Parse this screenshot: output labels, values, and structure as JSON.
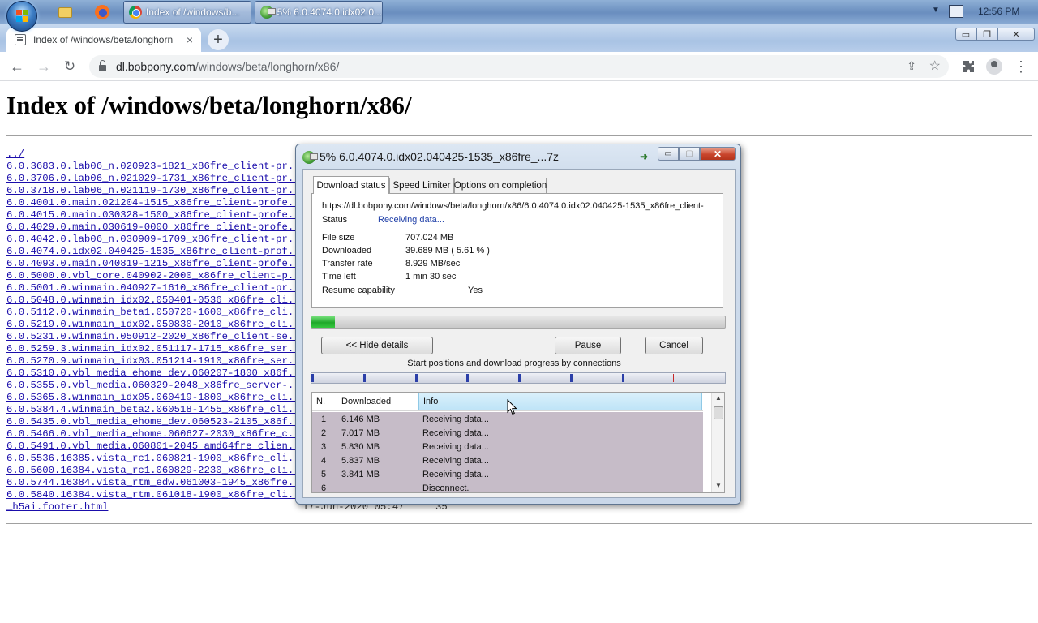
{
  "taskbar": {
    "tasks": [
      {
        "label": "Index of /windows/b..."
      },
      {
        "label": "5% 6.0.4074.0.idx02.0..."
      }
    ],
    "clock": "12:56 PM"
  },
  "chrome": {
    "tab_title": "Index of /windows/beta/longhorn",
    "tab_close": "×",
    "new_tab": "+",
    "url_host": "dl.bobpony.com",
    "url_path": "/windows/beta/longhorn/x86/"
  },
  "page": {
    "title": "Index of /windows/beta/longhorn/x86/",
    "links": [
      "../",
      "6.0.3683.0.lab06_n.020923-1821_x86fre_client-pr..>",
      "6.0.3706.0.lab06_n.021029-1731_x86fre_client-pr..>",
      "6.0.3718.0.lab06_n.021119-1730_x86fre_client-pr..>",
      "6.0.4001.0.main.021204-1515_x86fre_client-profe..>",
      "6.0.4015.0.main.030328-1500_x86fre_client-profe..>",
      "6.0.4029.0.main.030619-0000_x86fre_client-profe..>",
      "6.0.4042.0.lab06_n.030909-1709_x86fre_client-pr..>",
      "6.0.4074.0.idx02.040425-1535_x86fre_client-prof..>",
      "6.0.4093.0.main.040819-1215_x86fre_client-profe..>",
      "6.0.5000.0.vbl_core.040902-2000_x86fre_client-p..>",
      "6.0.5001.0.winmain.040927-1610_x86fre_client-pr..>",
      "6.0.5048.0.winmain_idx02.050401-0536_x86fre_cli..>",
      "6.0.5112.0.winmain_beta1.050720-1600_x86fre_cli..>",
      "6.0.5219.0.winmain_idx02.050830-2010_x86fre_cli..>",
      "6.0.5231.0.winmain.050912-2020_x86fre_client-se..>",
      "6.0.5259.3.winmain_idx02.051117-1715_x86fre_ser..>",
      "6.0.5270.9.winmain_idx03.051214-1910_x86fre_ser..>",
      "6.0.5310.0.vbl_media_ehome_dev.060207-1800_x86f..>",
      "6.0.5355.0.vbl_media.060329-2048_x86fre_server-..>",
      "6.0.5365.8.winmain_idx05.060419-1800_x86fre_cli..>",
      "6.0.5384.4.winmain_beta2.060518-1455_x86fre_cli..>",
      "6.0.5435.0.vbl_media_ehome_dev.060523-2105_x86f..>",
      "6.0.5466.0.vbl_media_ehome.060627-2030_x86fre_c..>",
      "6.0.5491.0.vbl_media.060801-2045_amd64fre_clien..>",
      "6.0.5536.16385.vista_rc1.060821-1900_x86fre_cli..>",
      "6.0.5600.16384.vista_rc1.060829-2230_x86fre_cli..>",
      "6.0.5744.16384.vista_rtm_edw.061003-1945_x86fre..>",
      "6.0.5840.16384.vista_rtm.061018-1900_x86fre_cli..>",
      "_h5ai.footer.html"
    ],
    "footer_date": "17-Jun-2020 05:47",
    "footer_size": "35"
  },
  "idm": {
    "title": "5% 6.0.4074.0.idx02.040425-1535_x86fre_...7z",
    "tabs": [
      "Download status",
      "Speed Limiter",
      "Options on completion"
    ],
    "url": "https://dl.bobpony.com/windows/beta/longhorn/x86/6.0.4074.0.idx02.040425-1535_x86fre_client-",
    "status_label": "Status",
    "status_value": "Receiving data...",
    "file_size_label": "File size",
    "file_size_value": "707.024  MB",
    "downloaded_label": "Downloaded",
    "downloaded_value": "39.689  MB  ( 5.61 % )",
    "transfer_rate_label": "Transfer rate",
    "transfer_rate_value": "8.929  MB/sec",
    "time_left_label": "Time left",
    "time_left_value": "1 min 30 sec",
    "resume_label": "Resume capability",
    "resume_value": "Yes",
    "progress_fraction": 0.0561,
    "hide_details_label": "<< Hide details",
    "pause_label": "Pause",
    "cancel_label": "Cancel",
    "connections_caption": "Start positions and download progress by connections",
    "connection_start_fractions": [
      0.0,
      0.125,
      0.25,
      0.375,
      0.5,
      0.625,
      0.75,
      0.875
    ],
    "columns": [
      "N.",
      "Downloaded",
      "Info"
    ],
    "connections": [
      {
        "n": "1",
        "downloaded": "6.146  MB",
        "info": "Receiving data..."
      },
      {
        "n": "2",
        "downloaded": "7.017  MB",
        "info": "Receiving data..."
      },
      {
        "n": "3",
        "downloaded": "5.830  MB",
        "info": "Receiving data..."
      },
      {
        "n": "4",
        "downloaded": "5.837  MB",
        "info": "Receiving data..."
      },
      {
        "n": "5",
        "downloaded": "3.841  MB",
        "info": "Receiving data..."
      },
      {
        "n": "6",
        "downloaded": "",
        "info": "Disconnect."
      }
    ]
  }
}
